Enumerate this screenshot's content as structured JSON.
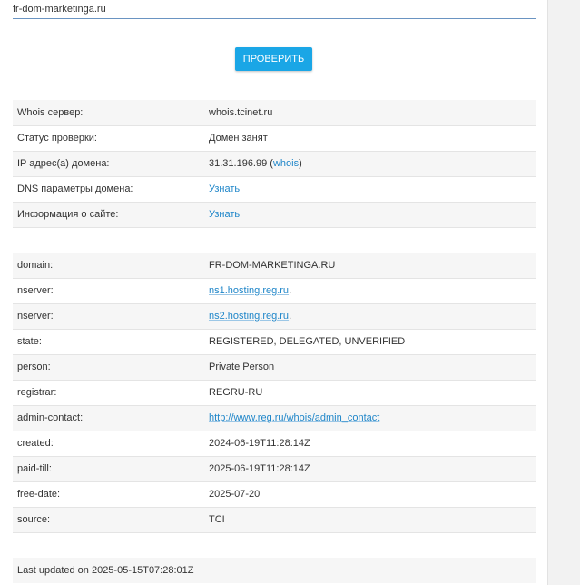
{
  "search": {
    "value": "fr-dom-marketinga.ru"
  },
  "check_button_label": "ПРОВЕРИТЬ",
  "whois_rows": [
    {
      "key": "Whois сервер:",
      "value": "whois.tcinet.ru"
    },
    {
      "key": "Статус проверки:",
      "value": "Домен занят"
    },
    {
      "key": "IP адрес(а) домена:",
      "value_prefix": "31.31.196.99 (",
      "link": "whois",
      "value_suffix": ")"
    },
    {
      "key": "DNS параметры домена:",
      "link": "Узнать"
    },
    {
      "key": "Информация о сайте:",
      "link": "Узнать"
    }
  ],
  "record_rows": [
    {
      "key": "domain:",
      "value": "FR-DOM-MARKETINGA.RU"
    },
    {
      "key": "nserver:",
      "link": "ns1.hosting.reg.ru",
      "value_suffix": "."
    },
    {
      "key": "nserver:",
      "link": "ns2.hosting.reg.ru",
      "value_suffix": "."
    },
    {
      "key": "state:",
      "value": "REGISTERED, DELEGATED, UNVERIFIED"
    },
    {
      "key": "person:",
      "value": "Private Person"
    },
    {
      "key": "registrar:",
      "value": "REGRU-RU"
    },
    {
      "key": "admin-contact:",
      "link": "http://www.reg.ru/whois/admin_contact"
    },
    {
      "key": "created:",
      "value": "2024-06-19T11:28:14Z"
    },
    {
      "key": "paid-till:",
      "value": "2025-06-19T11:28:14Z"
    },
    {
      "key": "free-date:",
      "value": "2025-07-20"
    },
    {
      "key": "source:",
      "value": "TCI"
    }
  ],
  "footer": {
    "last_updated": "Last updated on 2025-05-15T07:28:01Z"
  },
  "colors": {
    "accent": "#1aa6e6",
    "link": "#1f86c9",
    "row_stripe": "#f6f6f6"
  }
}
